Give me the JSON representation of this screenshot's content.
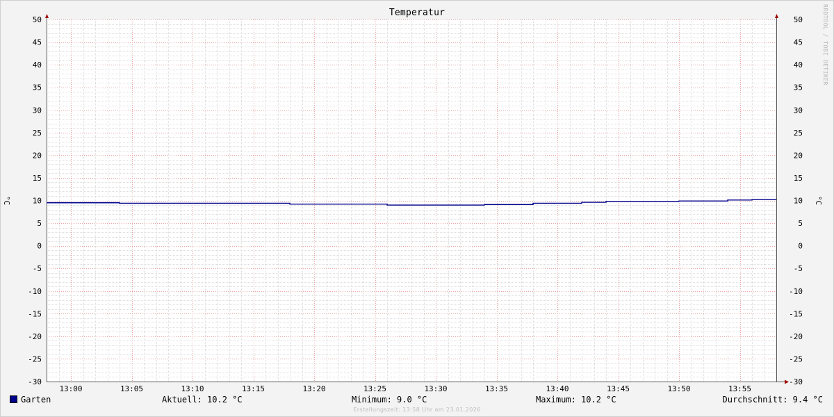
{
  "watermark": "RRDTOOL / TOBI OETIKER",
  "chart_data": {
    "type": "line",
    "title": "Temperatur",
    "ylabel": "°C",
    "ylim": [
      -30,
      50
    ],
    "yticks": [
      50,
      45,
      40,
      35,
      30,
      25,
      20,
      15,
      10,
      5,
      0,
      -5,
      -10,
      -15,
      -20,
      -25,
      -30
    ],
    "xlim": [
      "12:58",
      "13:58"
    ],
    "xticks": [
      "13:00",
      "13:05",
      "13:10",
      "13:15",
      "13:20",
      "13:25",
      "13:30",
      "13:35",
      "13:40",
      "13:45",
      "13:50",
      "13:55"
    ],
    "grid": true,
    "legend_position": "bottom-left",
    "series": [
      {
        "name": "Garten",
        "color": "#00008b",
        "step": true,
        "points": [
          [
            "12:58",
            9.5
          ],
          [
            "13:04",
            9.4
          ],
          [
            "13:18",
            9.2
          ],
          [
            "13:26",
            9.0
          ],
          [
            "13:34",
            9.1
          ],
          [
            "13:38",
            9.4
          ],
          [
            "13:42",
            9.6
          ],
          [
            "13:44",
            9.8
          ],
          [
            "13:50",
            9.9
          ],
          [
            "13:54",
            10.1
          ],
          [
            "13:56",
            10.2
          ],
          [
            "13:58",
            10.2
          ]
        ]
      }
    ]
  },
  "legend": {
    "series_name": "Garten",
    "swatch_color": "#00008b",
    "current": "Aktuell: 10.2 °C",
    "minimum": "Minimum: 9.0 °C",
    "maximum": "Maximum: 10.2 °C",
    "average": "Durchschnitt: 9.4 °C"
  },
  "footer": "Erstellungszeit: 13:58 Uhr am 23.01.2026"
}
